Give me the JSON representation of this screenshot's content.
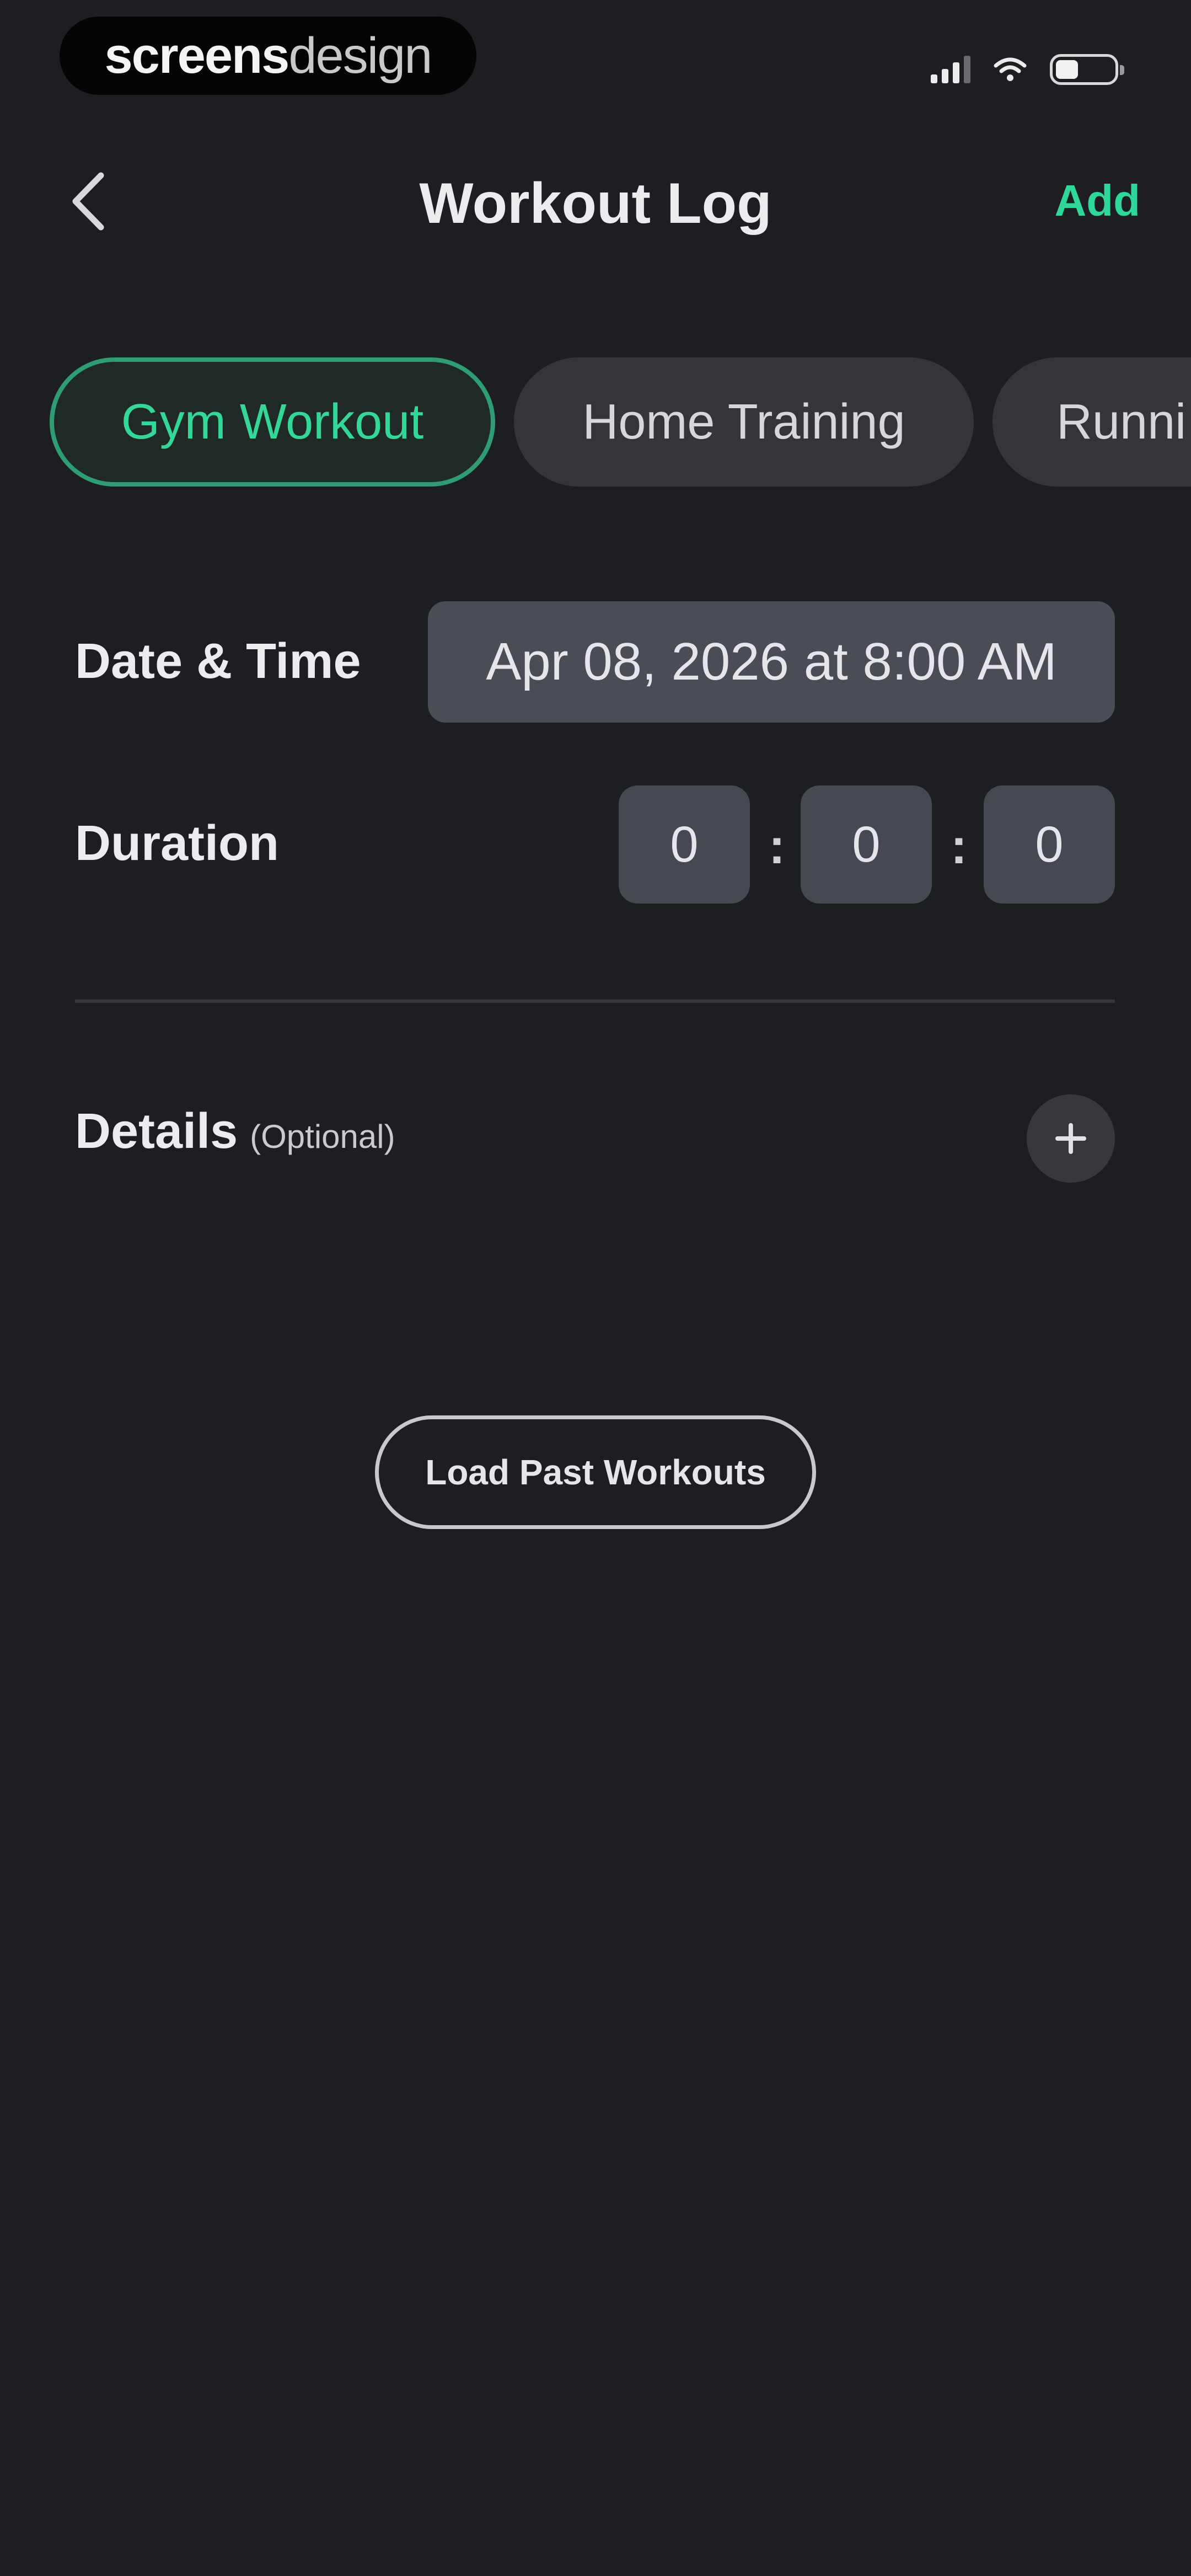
{
  "status_bar": {
    "brand_bold": "screens",
    "brand_light": "design"
  },
  "nav": {
    "title": "Workout Log",
    "add_label": "Add",
    "back_icon": "chevron-left-icon"
  },
  "tabs": [
    {
      "label": "Gym Workout",
      "selected": true
    },
    {
      "label": "Home Training",
      "selected": false
    },
    {
      "label": "Runni",
      "selected": false
    }
  ],
  "form": {
    "datetime_label": "Date & Time",
    "datetime_value": "Apr 08, 2026 at 8:00 AM",
    "duration_label": "Duration",
    "duration": {
      "hours": "0",
      "minutes": "0",
      "seconds": "0",
      "separator": ":"
    }
  },
  "details": {
    "label": "Details",
    "optional": "(Optional)",
    "add_icon": "plus-icon"
  },
  "actions": {
    "load_past_workouts": "Load Past Workouts"
  },
  "colors": {
    "background": "#1d1e22",
    "accent": "#2fd79a",
    "field": "#4a4c56",
    "chip": "#34353a"
  }
}
